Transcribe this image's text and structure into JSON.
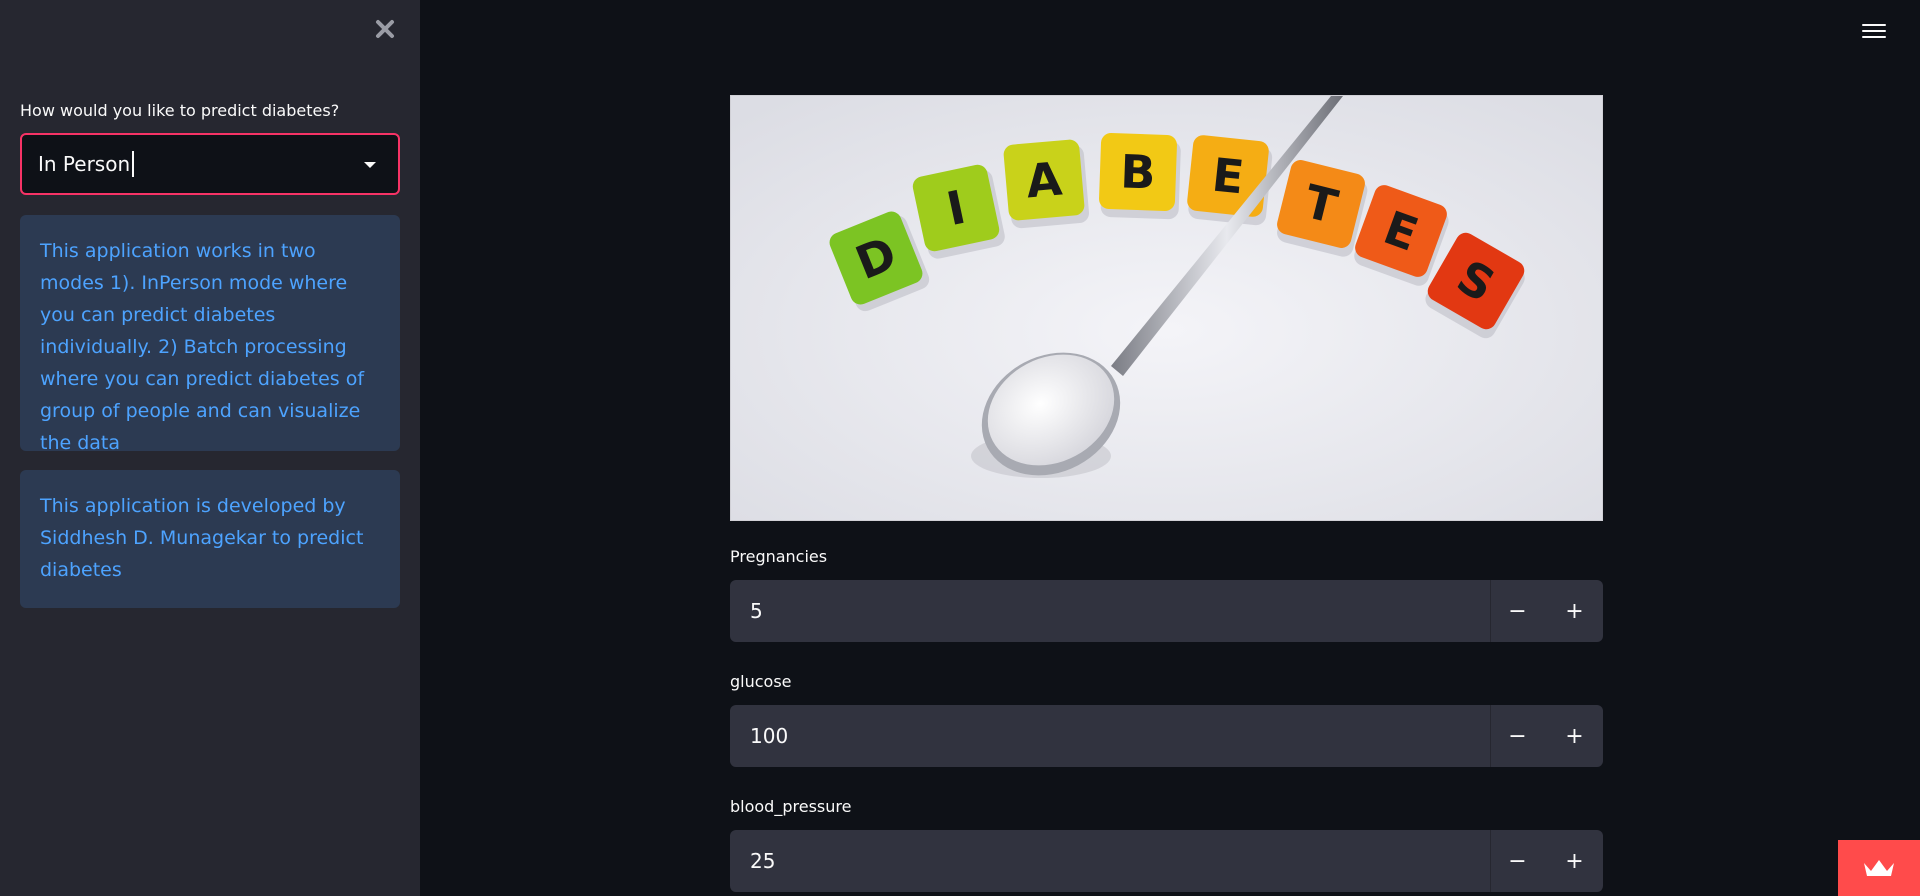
{
  "sidebar": {
    "close_icon": "close-icon",
    "mode_label": "How would you like to predict diabetes?",
    "mode_select": {
      "value": "In Person"
    },
    "info_text": "This application works in two modes 1). InPerson mode where you can predict diabetes individually. 2) Batch processing where you can predict diabetes of group of people and can visualize the data",
    "developer_text": "This application is developed by Siddhesh D. Munagekar to predict diabetes"
  },
  "header": {
    "menu_icon": "hamburger-menu-icon"
  },
  "main": {
    "hero_image": {
      "letters": [
        "D",
        "I",
        "A",
        "B",
        "E",
        "T",
        "E",
        "S"
      ],
      "tile_colors": [
        "#7cc423",
        "#9fcc1c",
        "#c9d21a",
        "#f2c915",
        "#f5ad14",
        "#f48a17",
        "#ef5a18",
        "#e23812"
      ]
    },
    "fields": [
      {
        "label": "Pregnancies",
        "value": "5",
        "decrement": "−",
        "increment": "+"
      },
      {
        "label": "glucose",
        "value": "100",
        "decrement": "−",
        "increment": "+"
      },
      {
        "label": "blood_pressure",
        "value": "25",
        "decrement": "−",
        "increment": "+"
      }
    ]
  },
  "badge": {
    "icon": "crown-icon",
    "color": "#ff4b4b"
  },
  "colors": {
    "accent": "#f63366",
    "info_text": "#4da3ff",
    "info_bg": "#2c3a52",
    "sidebar_bg": "#262730",
    "main_bg": "#0e1117"
  }
}
